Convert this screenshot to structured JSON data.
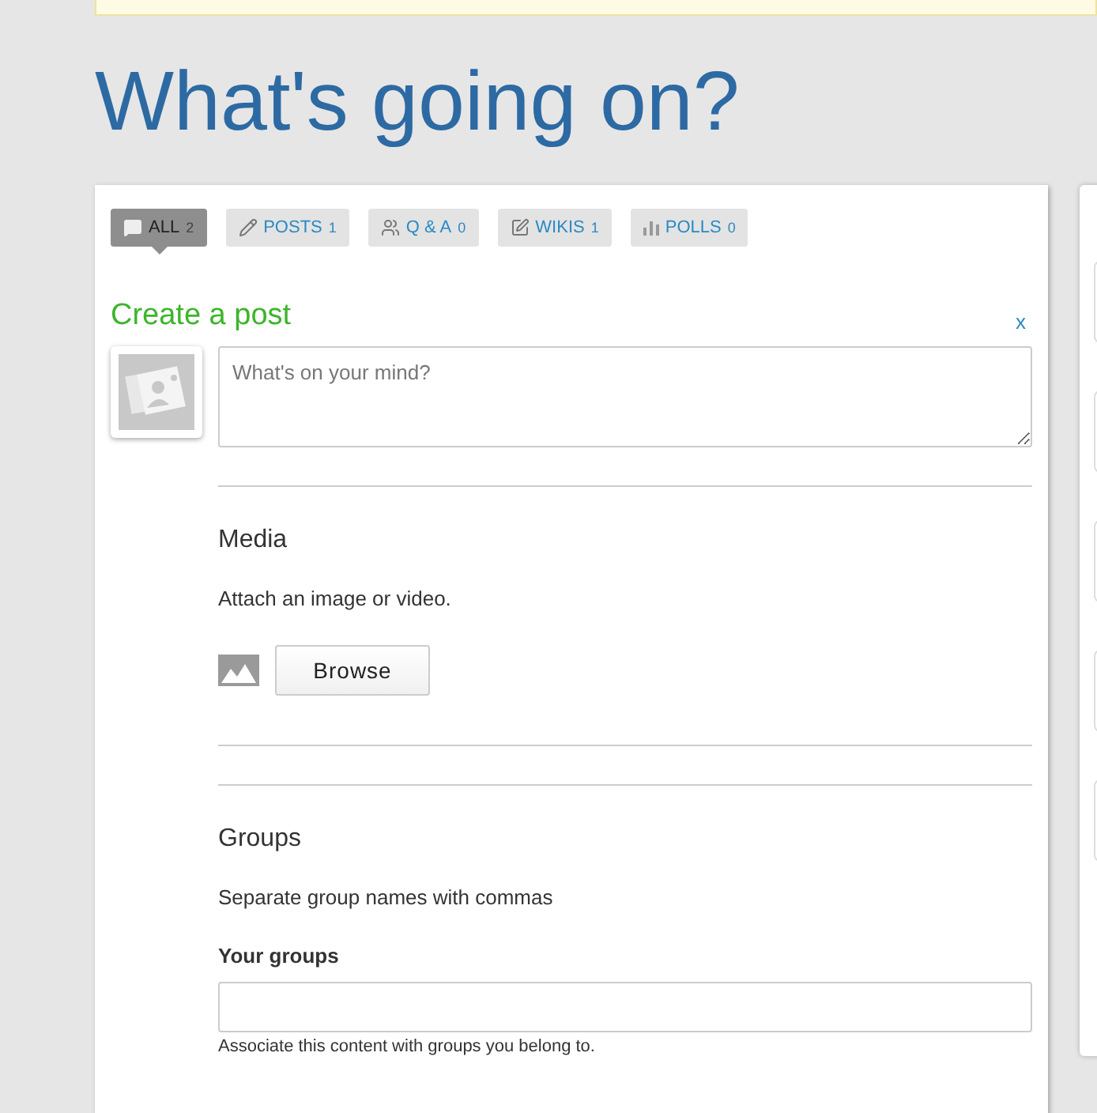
{
  "page_title": "What's going on?",
  "tabs": [
    {
      "kind": "all",
      "label": "ALL",
      "count": "2",
      "selected": true
    },
    {
      "kind": "posts",
      "label": "POSTS",
      "count": "1",
      "selected": false
    },
    {
      "kind": "qa",
      "label": "Q & A",
      "count": "0",
      "selected": false
    },
    {
      "kind": "wikis",
      "label": "WIKIS",
      "count": "1",
      "selected": false
    },
    {
      "kind": "polls",
      "label": "POLLS",
      "count": "0",
      "selected": false
    }
  ],
  "composer": {
    "title": "Create a post",
    "close": "x",
    "placeholder": "What's on your mind?"
  },
  "media": {
    "heading": "Media",
    "description": "Attach an image or video.",
    "button": "Browse"
  },
  "groups": {
    "heading": "Groups",
    "description": "Separate group names with commas",
    "field_label": "Your groups",
    "help": "Associate this content with groups you belong to."
  }
}
